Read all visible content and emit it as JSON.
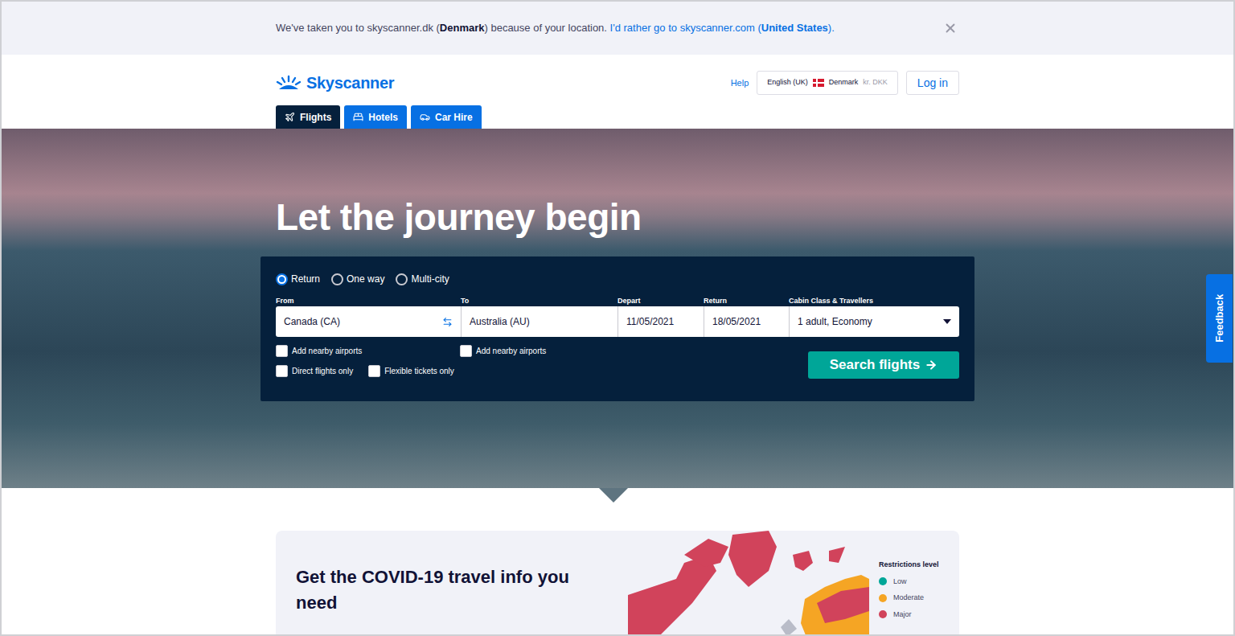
{
  "banner": {
    "message": [
      {
        "text": "We've taken you to skyscanner.dk (",
        "bold": false
      },
      {
        "text": "Denmark",
        "bold": true
      },
      {
        "text": ") because of your location.",
        "bold": false
      }
    ],
    "link": [
      {
        "text": "I'd rather go to skyscanner.com (",
        "bold": false
      },
      {
        "text": "United States",
        "bold": true
      },
      {
        "text": ").",
        "bold": false
      }
    ]
  },
  "header": {
    "logo": "Skyscanner",
    "help": "Help",
    "locale": {
      "language": "English (UK)",
      "country": "Denmark",
      "currency": "kr. DKK"
    },
    "login": "Log in"
  },
  "tabs": [
    {
      "label": "Flights",
      "selected": true
    },
    {
      "label": "Hotels",
      "selected": false
    },
    {
      "label": "Car Hire",
      "selected": false
    }
  ],
  "hero": {
    "headline": "Let the journey begin"
  },
  "search": {
    "trip_types": [
      {
        "label": "Return",
        "selected": true
      },
      {
        "label": "One way",
        "selected": false
      },
      {
        "label": "Multi-city",
        "selected": false
      }
    ],
    "fields": [
      {
        "label": "From",
        "value": "Canada (CA)",
        "kind": "swap"
      },
      {
        "label": "To",
        "value": "Australia (AU)",
        "kind": "plain"
      },
      {
        "label": "Depart",
        "value": "11/05/2021",
        "kind": "plain"
      },
      {
        "label": "Return",
        "value": "18/05/2021",
        "kind": "plain"
      },
      {
        "label": "Cabin Class & Travellers",
        "value": "1 adult, Economy",
        "kind": "dropdown"
      }
    ],
    "options_row1": [
      {
        "label": "Add nearby airports",
        "checked": false
      },
      {
        "label": "Add nearby airports",
        "checked": false
      }
    ],
    "options_row2": [
      {
        "label": "Direct flights only",
        "checked": false
      },
      {
        "label": "Flexible tickets only",
        "checked": false
      }
    ],
    "button": "Search flights"
  },
  "covid": {
    "title": "Get the COVID-19 travel info you need",
    "legend_title": "Restrictions level",
    "legend": [
      {
        "label": "Low",
        "color": "#00a698"
      },
      {
        "label": "Moderate",
        "color": "#f5a524"
      },
      {
        "label": "Major",
        "color": "#d1435b"
      }
    ]
  },
  "feedback": "Feedback"
}
